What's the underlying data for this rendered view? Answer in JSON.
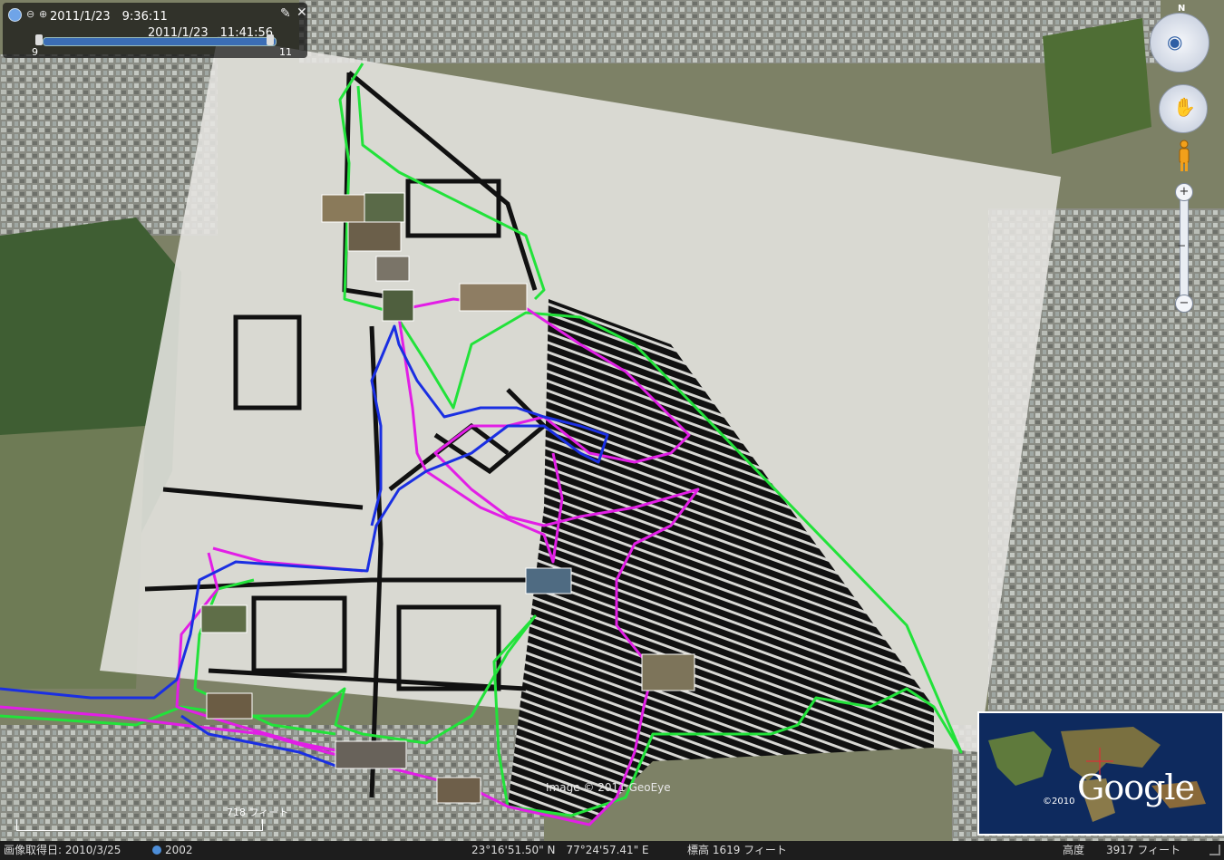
{
  "time_slider": {
    "start": "2011/1/23　9:36:11",
    "end": "2011/1/23　11:41:56",
    "min_label": "9",
    "max_label": "11"
  },
  "navigation": {
    "north": "N",
    "zoom_in": "+",
    "zoom_out": "−",
    "zoom_mid": "−",
    "accent_color": "#3b6db5"
  },
  "map": {
    "credit": "Image © 2011 GeoEye",
    "scale": "718 フィート",
    "track_colors": {
      "green": "#22e23a",
      "magenta": "#e21ee6",
      "blue": "#1a2fe2"
    }
  },
  "overview_map": {
    "logo": "Google",
    "year": "©2010"
  },
  "status_bar": {
    "imagery_date": "画像取得日: 2010/3/25",
    "historic_year": "2002",
    "coords": "23°16'51.50\" N　77°24'57.41\" E",
    "elevation": "標高  1619 フィート",
    "eye_alt": "高度　　3917 フィート"
  }
}
